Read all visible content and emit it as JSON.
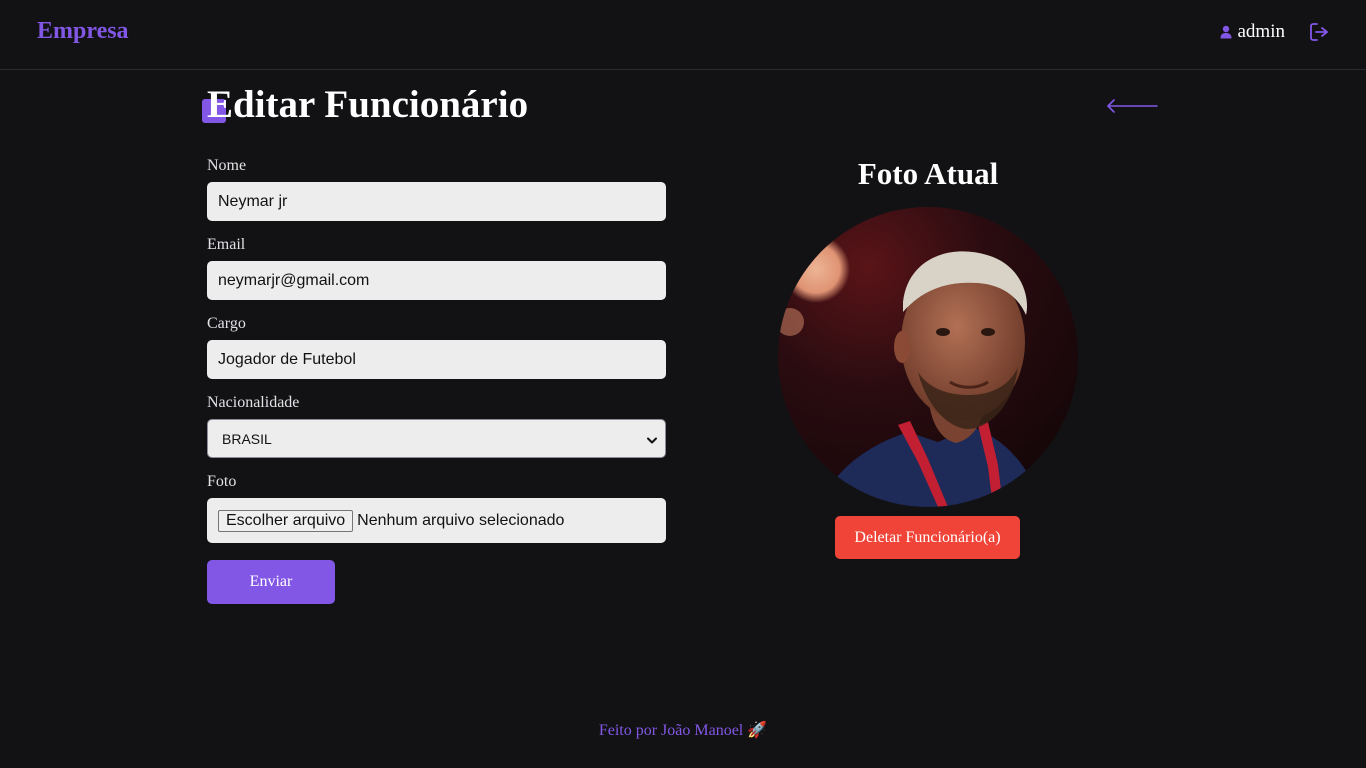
{
  "header": {
    "brand": "Empresa",
    "username": "admin",
    "user_icon": "user-icon",
    "logout_icon": "logout-icon"
  },
  "page": {
    "title": "Editar Funcionário",
    "back_icon": "arrow-left-icon"
  },
  "form": {
    "nome_label": "Nome",
    "nome_value": "Neymar jr",
    "email_label": "Email",
    "email_value": "neymarjr@gmail.com",
    "cargo_label": "Cargo",
    "cargo_value": "Jogador de Futebol",
    "nacionalidade_label": "Nacionalidade",
    "nacionalidade_value": "BRASIL",
    "foto_label": "Foto",
    "file_button": "Escolher arquivo",
    "file_status": "Nenhum arquivo selecionado",
    "submit_label": "Enviar"
  },
  "photo": {
    "title": "Foto Atual",
    "delete_label": "Deletar Funcionário(a)"
  },
  "footer": {
    "text": "Feito por João Manoel 🚀"
  },
  "colors": {
    "background": "#121214",
    "accent": "#8257e5",
    "danger": "#f04438",
    "input_bg": "#ededed"
  }
}
